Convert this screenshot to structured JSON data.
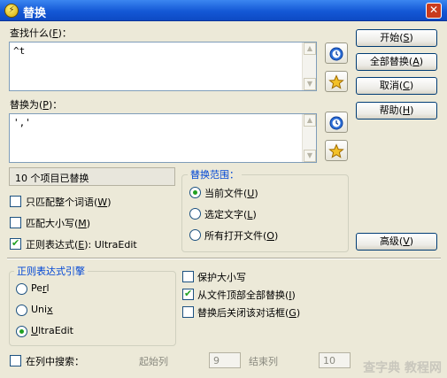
{
  "window": {
    "title": "替换",
    "app_icon_glyph": "⚡",
    "close_glyph": "✕"
  },
  "find": {
    "label": "查找什么(",
    "label_hotkey": "F",
    "label_end": ")：",
    "value": "^t"
  },
  "replace": {
    "label": "替换为(",
    "label_hotkey": "P",
    "label_end": ")：",
    "value": "','"
  },
  "buttons": {
    "start": {
      "text": "开始(",
      "hotkey": "S",
      "end": ")"
    },
    "replace_all": {
      "text": "全部替换(",
      "hotkey": "A",
      "end": ")"
    },
    "cancel": {
      "text": "取消(",
      "hotkey": "C",
      "end": ")"
    },
    "help": {
      "text": "帮助(",
      "hotkey": "H",
      "end": ")"
    },
    "advanced": {
      "text": "高级(",
      "hotkey": "V",
      "end": ")"
    }
  },
  "status_text": "10 个项目已替换",
  "options": {
    "whole_word": {
      "text": "只匹配整个词语(",
      "hotkey": "W",
      "end": ")",
      "checked": false
    },
    "match_case": {
      "text": "匹配大小写(",
      "hotkey": "M",
      "end": ")",
      "checked": false
    },
    "regex": {
      "text": "正则表达式(",
      "hotkey": "E",
      "end": "): UltraEdit",
      "checked": true
    }
  },
  "scope": {
    "title": "替换范围：",
    "current_file": {
      "text": "当前文件(",
      "hotkey": "U",
      "end": ")",
      "selected": true
    },
    "selected_text": {
      "text": "选定文字(",
      "hotkey": "L",
      "end": ")",
      "selected": false
    },
    "all_open_files": {
      "text": "所有打开文件(",
      "hotkey": "O",
      "end": ")",
      "selected": false
    }
  },
  "regex_engine": {
    "title": "正则表达式引擎",
    "perl": {
      "text": "Pe",
      "hotkey": "r",
      "end": "l",
      "selected": false
    },
    "unix": {
      "text": "Uni",
      "hotkey": "x",
      "end": "",
      "selected": false
    },
    "ultraedit": {
      "text": "",
      "hotkey": "U",
      "end": "ltraEdit",
      "selected": true
    }
  },
  "options2": {
    "preserve_case": {
      "text": "保护大小写",
      "checked": false
    },
    "from_top": {
      "text": "从文件顶部全部替换(",
      "hotkey": "I",
      "end": ")",
      "checked": true
    },
    "close_after": {
      "text": "替换后关闭该对话框(",
      "hotkey": "G",
      "end": ")",
      "checked": false
    }
  },
  "column_search": {
    "label": "在列中搜索：",
    "start_label": "起始列",
    "start_value": "9",
    "end_label": "结束列",
    "end_value": "10"
  },
  "watermark": "查字典 教程网",
  "colors": {
    "titlebar": "#1458d6",
    "group_title": "#0046d5",
    "check": "#21a121"
  }
}
